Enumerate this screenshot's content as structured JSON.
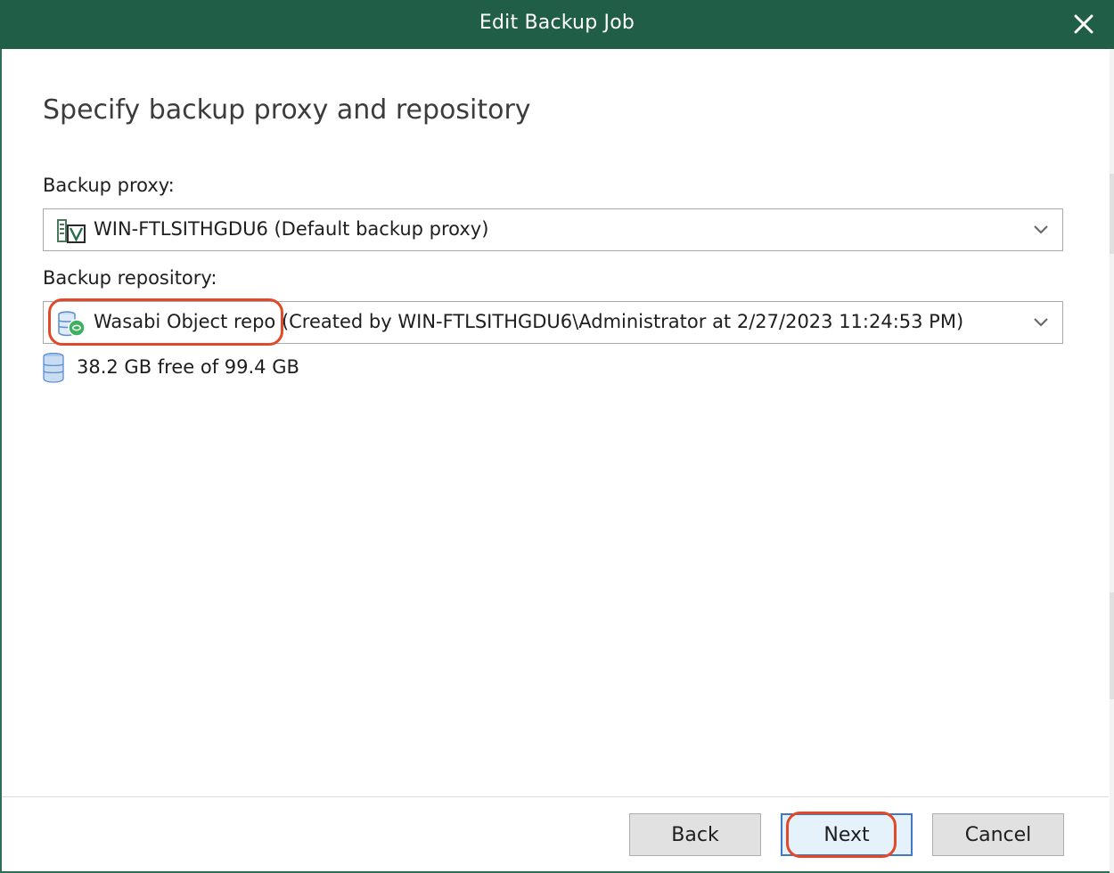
{
  "window": {
    "title": "Edit Backup Job",
    "close_icon": "close-icon"
  },
  "page": {
    "title": "Specify backup proxy and repository"
  },
  "proxy": {
    "label": "Backup proxy:",
    "value": "WIN-FTLSITHGDU6 (Default backup proxy)",
    "icon": "proxy-server-icon"
  },
  "repository": {
    "label": "Backup repository:",
    "value": "Wasabi Object repo (Created by WIN-FTLSITHGDU6\\Administrator at 2/27/2023 11:24:53 PM)",
    "icon": "object-storage-repository-icon",
    "free_space": "38.2 GB free of 99.4 GB",
    "free_space_icon": "database-icon"
  },
  "buttons": {
    "back": "Back",
    "next": "Next",
    "cancel": "Cancel"
  },
  "colors": {
    "titlebar": "#215e48",
    "highlight": "#e04a2b",
    "primary_button_border": "#3f78c8"
  }
}
